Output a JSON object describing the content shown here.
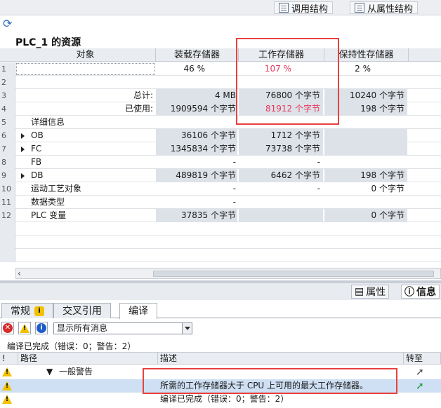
{
  "toolbar": {
    "call_structure": "调用结构",
    "dependency_structure": "从属性结构"
  },
  "title": "PLC_1 的资源",
  "table": {
    "headers": [
      "对象",
      "装载存储器",
      "工作存储器",
      "保持性存储器"
    ],
    "rows": [
      {
        "num": "1",
        "label": "",
        "load": "46 %",
        "work": "107 %",
        "retain": "2 %"
      },
      {
        "num": "2",
        "label": "",
        "load": "",
        "work": "",
        "retain": ""
      },
      {
        "num": "3",
        "label": "总计:",
        "load": "4 MB",
        "work": "76800 个字节",
        "retain": "10240 个字节"
      },
      {
        "num": "4",
        "label": "已使用:",
        "load": "1909594 个字节",
        "work": "81912 个字节",
        "retain": "198 个字节"
      },
      {
        "num": "5",
        "label": "详细信息",
        "load": "",
        "work": "",
        "retain": ""
      },
      {
        "num": "6",
        "label": "OB",
        "load": "36106 个字节",
        "work": "1712 个字节",
        "retain": ""
      },
      {
        "num": "7",
        "label": "FC",
        "load": "1345834 个字节",
        "work": "73738 个字节",
        "retain": ""
      },
      {
        "num": "8",
        "label": "FB",
        "load": "-",
        "work": "-",
        "retain": ""
      },
      {
        "num": "9",
        "label": "DB",
        "load": "489819 个字节",
        "work": "6462 个字节",
        "retain": "198 个字节"
      },
      {
        "num": "10",
        "label": "运动工艺对象",
        "load": "-",
        "work": "-",
        "retain": "0 个字节"
      },
      {
        "num": "11",
        "label": "数据类型",
        "load": "-",
        "work": "",
        "retain": ""
      },
      {
        "num": "12",
        "label": "PLC 变量",
        "load": "37835 个字节",
        "work": "",
        "retain": "0 个字节"
      }
    ]
  },
  "panel_tabs": {
    "properties": "属性",
    "info": "信息"
  },
  "info_tabs": {
    "general": "常规",
    "cross_ref": "交叉引用",
    "compile": "编译"
  },
  "filter": {
    "value": "显示所有消息"
  },
  "compile_status": "编译已完成（错误：0；警告：2）",
  "messages": {
    "headers": {
      "path": "路径",
      "desc": "描述",
      "goto": "转至"
    },
    "rows": [
      {
        "path": "一般警告",
        "desc": ""
      },
      {
        "path": "",
        "desc": "所需的工作存储器大于 CPU 上可用的最大工作存储器。"
      },
      {
        "path": "",
        "desc": "编译已完成（错误：0；警告：2）"
      }
    ]
  },
  "colors": {
    "highlight": "#e8413e",
    "overflow_text": "#e8365a",
    "selection": "#cfe0f4"
  }
}
